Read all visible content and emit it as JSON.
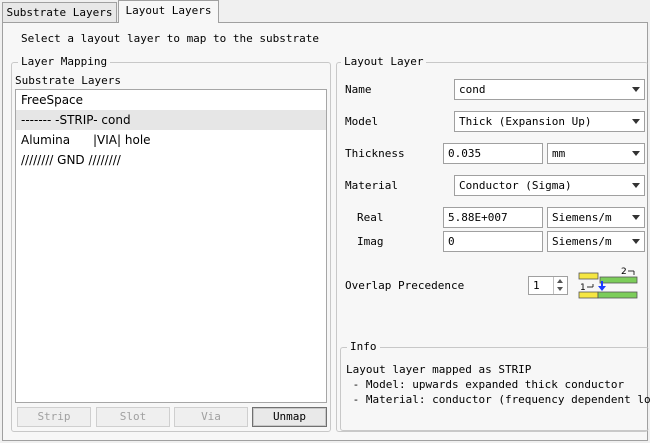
{
  "tabs": [
    {
      "label": "Substrate Layers",
      "active": false
    },
    {
      "label": "Layout Layers",
      "active": true
    }
  ],
  "instruction": "Select a layout layer to map to the substrate",
  "layer_mapping": {
    "group_title": "Layer Mapping",
    "list_title": "Substrate Layers",
    "items": [
      {
        "label": "FreeSpace",
        "selected": false
      },
      {
        "label": "------- -STRIP- cond",
        "selected": true
      },
      {
        "label": "Alumina      |VIA| hole",
        "selected": false
      },
      {
        "label": "//////// GND ////////",
        "selected": false
      }
    ],
    "buttons": {
      "strip": "Strip",
      "slot": "Slot",
      "via": "Via",
      "unmap": "Unmap"
    }
  },
  "layout_layer": {
    "group_title": "Layout Layer",
    "name_label": "Name",
    "name_value": "cond",
    "model_label": "Model",
    "model_value": "Thick (Expansion Up)",
    "thickness_label": "Thickness",
    "thickness_value": "0.035",
    "thickness_unit": "mm",
    "material_label": "Material",
    "material_value": "Conductor (Sigma)",
    "real_label": "Real",
    "real_value": "5.88E+007",
    "real_unit": "Siemens/m",
    "imag_label": "Imag",
    "imag_value": "0",
    "imag_unit": "Siemens/m",
    "overlap_label": "Overlap Precedence",
    "overlap_value": "1",
    "overlap_icon_labels": {
      "top": "2",
      "bottom": "1"
    }
  },
  "info": {
    "group_title": "Info",
    "line1": "Layout layer mapped as STRIP",
    "line2": " - Model: upwards expanded thick conductor",
    "line3": " - Material: conductor (frequency dependent loss)"
  },
  "colors": {
    "overlap_yellow": "#f5e642",
    "overlap_green": "#7ccd5a",
    "overlap_arrow": "#1a3cff"
  }
}
